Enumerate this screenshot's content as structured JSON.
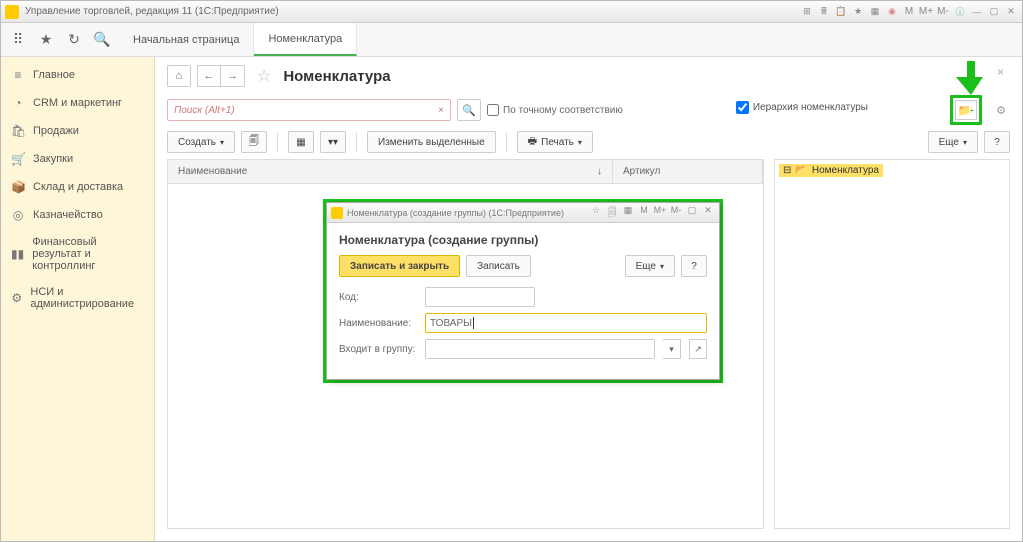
{
  "window": {
    "title": "Управление торговлей, редакция 11  (1С:Предприятие)",
    "m_labels": [
      "M",
      "M+",
      "M-"
    ]
  },
  "tabs": {
    "start": "Начальная страница",
    "active": "Номенклатура"
  },
  "sidebar": {
    "items": [
      {
        "icon": "≡",
        "label": "Главное"
      },
      {
        "icon": "◔",
        "label": "CRM и маркетинг"
      },
      {
        "icon": "🛍",
        "label": "Продажи"
      },
      {
        "icon": "🛒",
        "label": "Закупки"
      },
      {
        "icon": "📦",
        "label": "Склад и доставка"
      },
      {
        "icon": "◎",
        "label": "Казначейство"
      },
      {
        "icon": "▮▮",
        "label": "Финансовый результат и контроллинг"
      },
      {
        "icon": "⚙",
        "label": "НСИ и администрирование"
      }
    ]
  },
  "content": {
    "title": "Номенклатура",
    "search_placeholder": "Поиск (Alt+1)",
    "search_x": "×",
    "exact_match": "По точному соответствию",
    "hierarchy": "Иерархия номенклатуры",
    "btn_create": "Создать",
    "btn_change_selected": "Изменить выделенные",
    "btn_print": "Печать",
    "btn_more": "Еще",
    "col_name": "Наименование",
    "col_article": "Артикул",
    "sort_arrow": "↓"
  },
  "tree": {
    "root": "Номенклатура",
    "minus": "⊟"
  },
  "dialog": {
    "window_title": "Номенклатура (создание группы)  (1С:Предприятие)",
    "heading": "Номенклатура (создание группы)",
    "btn_save_close": "Записать и закрыть",
    "btn_save": "Записать",
    "btn_more": "Еще",
    "help": "?",
    "lbl_code": "Код:",
    "lbl_name": "Наименование:",
    "lbl_group": "Входит в группу:",
    "val_name": "ТОВАРЫ",
    "m_labels": [
      "M",
      "M+",
      "M-"
    ]
  }
}
